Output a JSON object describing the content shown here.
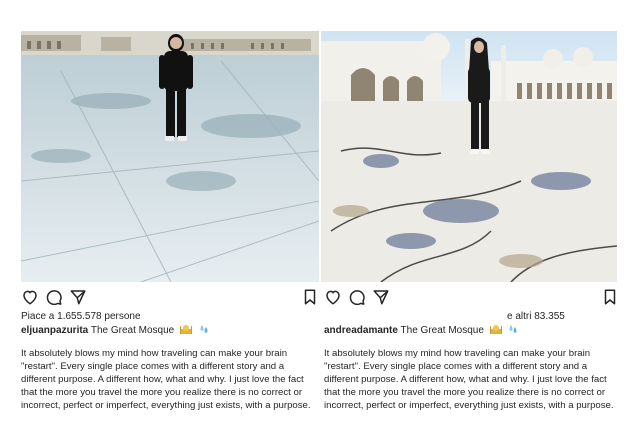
{
  "posts": [
    {
      "likes_text": "Piace a 1.655.578 persone",
      "username": "eljuanpazurita",
      "location": "The Great Mosque",
      "caption": "It absolutely blows my mind how traveling can make your brain \"restart\". Every single place comes with a different story and a different purpose. A different how, what and why. I just love the fact that the more you travel the more you realize there is no correct or incorrect, perfect or imperfect, everything just exists, with a purpose."
    },
    {
      "likes_text": "e altri 83.355",
      "username": "andreadamante",
      "location": "The Great Mosque",
      "caption": "It absolutely blows my mind how traveling can make your brain \"restart\". Every single place comes with a different story and a different purpose. A different how, what and why. I just love the fact that the more you travel the more you realize there is no correct or incorrect, perfect or imperfect, everything just exists, with a purpose."
    }
  ],
  "icons": [
    "heart-icon",
    "comment-icon",
    "share-icon",
    "bookmark-icon",
    "mosque-emoji",
    "droplets-emoji"
  ]
}
